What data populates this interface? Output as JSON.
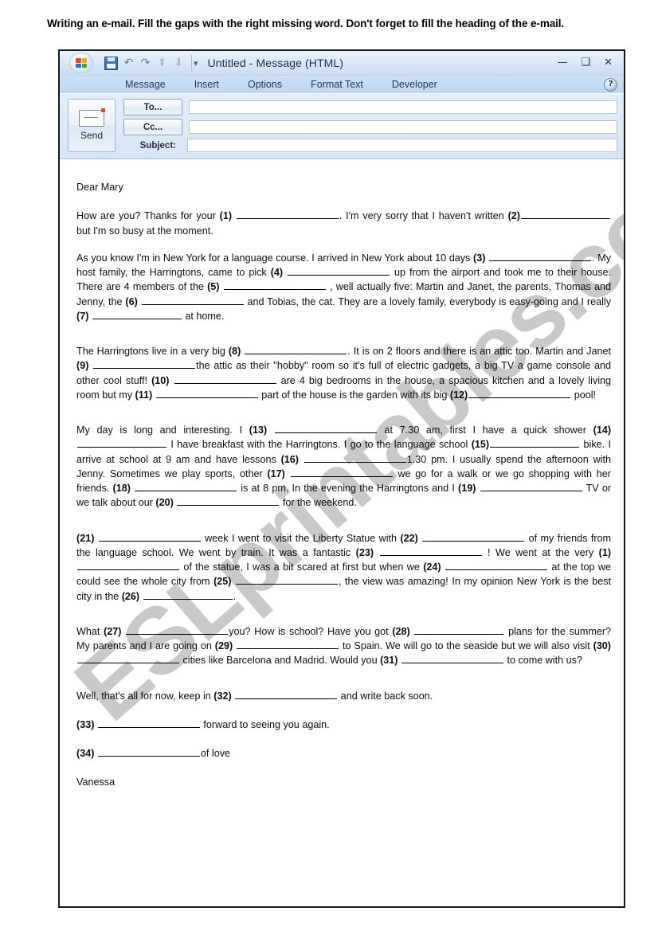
{
  "instruction": "Writing an e-mail.  Fill the gaps with the right missing word.  Don't forget to fill the heading of the e-mail.",
  "watermark": "ESLprintables.com",
  "outlook": {
    "window_title": "Untitled - Message (HTML)",
    "orb_icon": "office-orb-icon",
    "quick_access": [
      {
        "name": "save-icon",
        "label": "Save"
      },
      {
        "name": "undo-icon",
        "label": "↶"
      },
      {
        "name": "redo-icon",
        "label": "↷"
      },
      {
        "name": "previous-item-icon",
        "label": "⬆"
      },
      {
        "name": "next-item-icon",
        "label": "⬇"
      },
      {
        "name": "customize-quick-access-caret",
        "label": "▾"
      }
    ],
    "window_buttons": {
      "minimize": "—",
      "maximize": "❑",
      "close": "✕"
    },
    "tabs": [
      "Message",
      "Insert",
      "Options",
      "Format Text",
      "Developer"
    ],
    "help_label": "?",
    "send_button": "Send",
    "to_button": "To...",
    "cc_button": "Cc...",
    "subject_label": "Subject:",
    "to_value": "",
    "cc_value": "",
    "subject_value": ""
  },
  "letter": {
    "salutation": "Dear Mary",
    "p1": {
      "a": "How are you? Thanks for your",
      "n1": "(1)",
      "b": ".   I'm very sorry that I haven't written",
      "n2": "(2)",
      "c": " but I'm so busy at the moment."
    },
    "p2": {
      "a": "As you know I'm in New York for a language course. I arrived in New York about 10 days",
      "n3": "(3)",
      "b": ".  My host family, the Harringtons, came to pick",
      "n4": "(4)",
      "c": " up from the airport and took me to their house.   There are 4 members of the",
      "n5": "(5)",
      "d": " , well actually five: Martin and Janet, the parents, Thomas and Jenny, the",
      "n6": "(6)",
      "e": " and Tobias, the cat. They are a lovely family, everybody is easy-going and I really",
      "n7": "(7)",
      "f": " at home."
    },
    "p3": {
      "a": "The Harringtons live in a very big",
      "n8": "(8)",
      "b": ".  It is on 2 floors and there is an attic too. Martin and Janet",
      "n9": "(9)",
      "c": "the attic as their \"hobby\" room so it's full of electric gadgets, a big TV a game console and other cool stuff!",
      "n10": "(10)",
      "d": " are 4 big bedrooms in the house, a spacious kitchen and a lovely living room but my",
      "n11": "(11)",
      "e": " part of the house is the garden with its big",
      "n12": "(12)",
      "f": " pool!"
    },
    "p4": {
      "a": "My day is long and interesting.  I",
      "n13": "(13)",
      "b": " at 7.30 am, first I have a quick shower",
      "n14": "(14)",
      "c": " I have breakfast with the Harringtons. I go to the language school",
      "n15": "(15)",
      "d": " bike.  I arrive at school at 9 am and have lessons",
      "n16": "(16)",
      "e": "1.30 pm. I usually spend the afternoon with Jenny.  Sometimes we play sports, other",
      "n17": "(17)",
      "f": " we go for a walk or we go shopping with her friends.",
      "n18": "(18)",
      "g": " is at 8 pm.  In the evening the Harringtons and I",
      "n19": "(19)",
      "h": " TV or we talk about our",
      "n20": "(20)",
      "i": " for the weekend."
    },
    "p5": {
      "n21": "(21)",
      "a": " week I went to visit the Liberty Statue with",
      "n22": "(22)",
      "b": " of my friends from the language school.  We went by train.  It was a fantastic",
      "n23": "(23)",
      "c": " !  We went at the very",
      "n1b": "(1)",
      "d": " of the statue, I was a bit scared at first but when we",
      "n24": "(24)",
      "e": " at the top we could see the whole city from",
      "n25": "(25)",
      "f": ", the view was amazing!  In my opinion New York is the best city in the",
      "n26": "(26)",
      "g": "."
    },
    "p6": {
      "a": "What",
      "n27": "(27)",
      "b": "you?  How is school?  Have you got",
      "n28": "(28)",
      "c": " plans for the summer?  My parents and I are going on",
      "n29": "(29)",
      "d": " to Spain.  We will go to the seaside but we will also visit",
      "n30": "(30)",
      "e": " cities like Barcelona and Madrid.  Would you",
      "n31": "(31)",
      "f": " to come with us?"
    },
    "p7": {
      "a": "Well, that's all for now, keep in",
      "n32": "(32)",
      "b": " and write back soon."
    },
    "p8": {
      "n33": "(33)",
      "a": " forward to seeing you again."
    },
    "p9": {
      "n34": "(34)",
      "a": "of love"
    },
    "signature": "Vanessa"
  }
}
